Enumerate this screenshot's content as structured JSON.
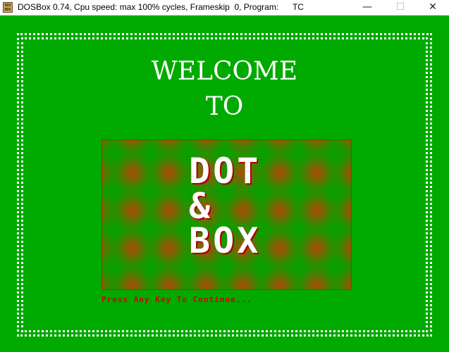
{
  "window": {
    "icon_text": "DOS BOX",
    "title": "DOSBox 0.74, Cpu speed: max 100% cycles, Frameskip  0, Program:      TC",
    "minimize_glyph": "—",
    "maximize_glyph": "☐",
    "close_glyph": "✕"
  },
  "game": {
    "welcome_line1": "WELCOME",
    "welcome_line2": "TO",
    "title_line1": "DOT",
    "title_line2": "&",
    "title_line3": "BOX",
    "prompt": "Press Any Key To Continue..."
  },
  "colors": {
    "background": "#00aa00",
    "grid_fill": "#8a5500",
    "text": "#ffffff",
    "prompt": "#cc0000"
  }
}
